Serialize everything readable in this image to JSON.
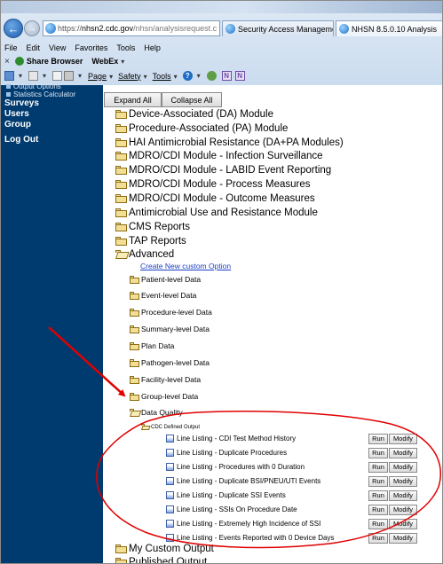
{
  "browser": {
    "url_proto": "https://",
    "url_host": "nhsn2.cdc.gov",
    "url_rest": "/nhsn/analysisrequest.c",
    "tabs": [
      {
        "label": "Security Access Management ..."
      },
      {
        "label": "NHSN 8.5.0.10 Analysis"
      }
    ],
    "menu": [
      "File",
      "Edit",
      "View",
      "Favorites",
      "Tools",
      "Help"
    ],
    "share_label": "Share Browser",
    "webex_label": "WebEx",
    "commands": {
      "page": "Page",
      "safety": "Safety",
      "tools": "Tools"
    },
    "cmd_n1": "N",
    "cmd_n2": "N"
  },
  "sidebar": {
    "sub_items": [
      "Output Options",
      "Statistics Calculator"
    ],
    "items": [
      "Surveys",
      "Users",
      "Group"
    ],
    "logout": "Log Out"
  },
  "main": {
    "expand_all": "Expand All",
    "collapse_all": "Collapse All",
    "top_folders": [
      "Device-Associated (DA) Module",
      "Procedure-Associated (PA) Module",
      "HAI Antimicrobial Resistance (DA+PA Modules)",
      "MDRO/CDI Module - Infection Surveillance",
      "MDRO/CDI Module - LABID Event Reporting",
      "MDRO/CDI Module - Process Measures",
      "MDRO/CDI Module - Outcome Measures",
      "Antimicrobial Use and Resistance Module",
      "CMS Reports",
      "TAP Reports",
      "Advanced"
    ],
    "create_link": "Create New custom Option",
    "advanced_folders": [
      "Patient-level Data",
      "Event-level Data",
      "Procedure-level Data",
      "Summary-level Data",
      "Plan Data",
      "Pathogen-level Data",
      "Facility-level Data",
      "Group-level Data",
      "Data Quality"
    ],
    "cdc_defined": "CDC Defined Output",
    "line_listings": [
      {
        "label": "Line Listing - CDI Test Method History",
        "run": "Run",
        "modify": "Modify"
      },
      {
        "label": "Line Listing - Duplicate Procedures",
        "run": "Run",
        "modify": "Modify"
      },
      {
        "label": "Line Listing - Procedures with 0 Duration",
        "run": "Run",
        "modify": "Modify"
      },
      {
        "label": "Line Listing - Duplicate BSI/PNEU/UTI Events",
        "run": "Run",
        "modify": "Modify"
      },
      {
        "label": "Line Listing - Duplicate SSI Events",
        "run": "Run",
        "modify": "Modify"
      },
      {
        "label": "Line Listing - SSIs On Procedure Date",
        "run": "Run",
        "modify": "Modify"
      },
      {
        "label": "Line Listing - Extremely High Incidence of SSI",
        "run": "Run",
        "modify": "Modify"
      },
      {
        "label": "Line Listing - Events Reported with 0 Device Days",
        "run": "Run",
        "modify": "Modify"
      }
    ],
    "bottom_folders": [
      "My Custom Output",
      "Published Output"
    ]
  },
  "colors": {
    "sidebar_bg": "#003b6f",
    "annotation_red": "#e00000",
    "link_blue": "#1a3fc7"
  }
}
